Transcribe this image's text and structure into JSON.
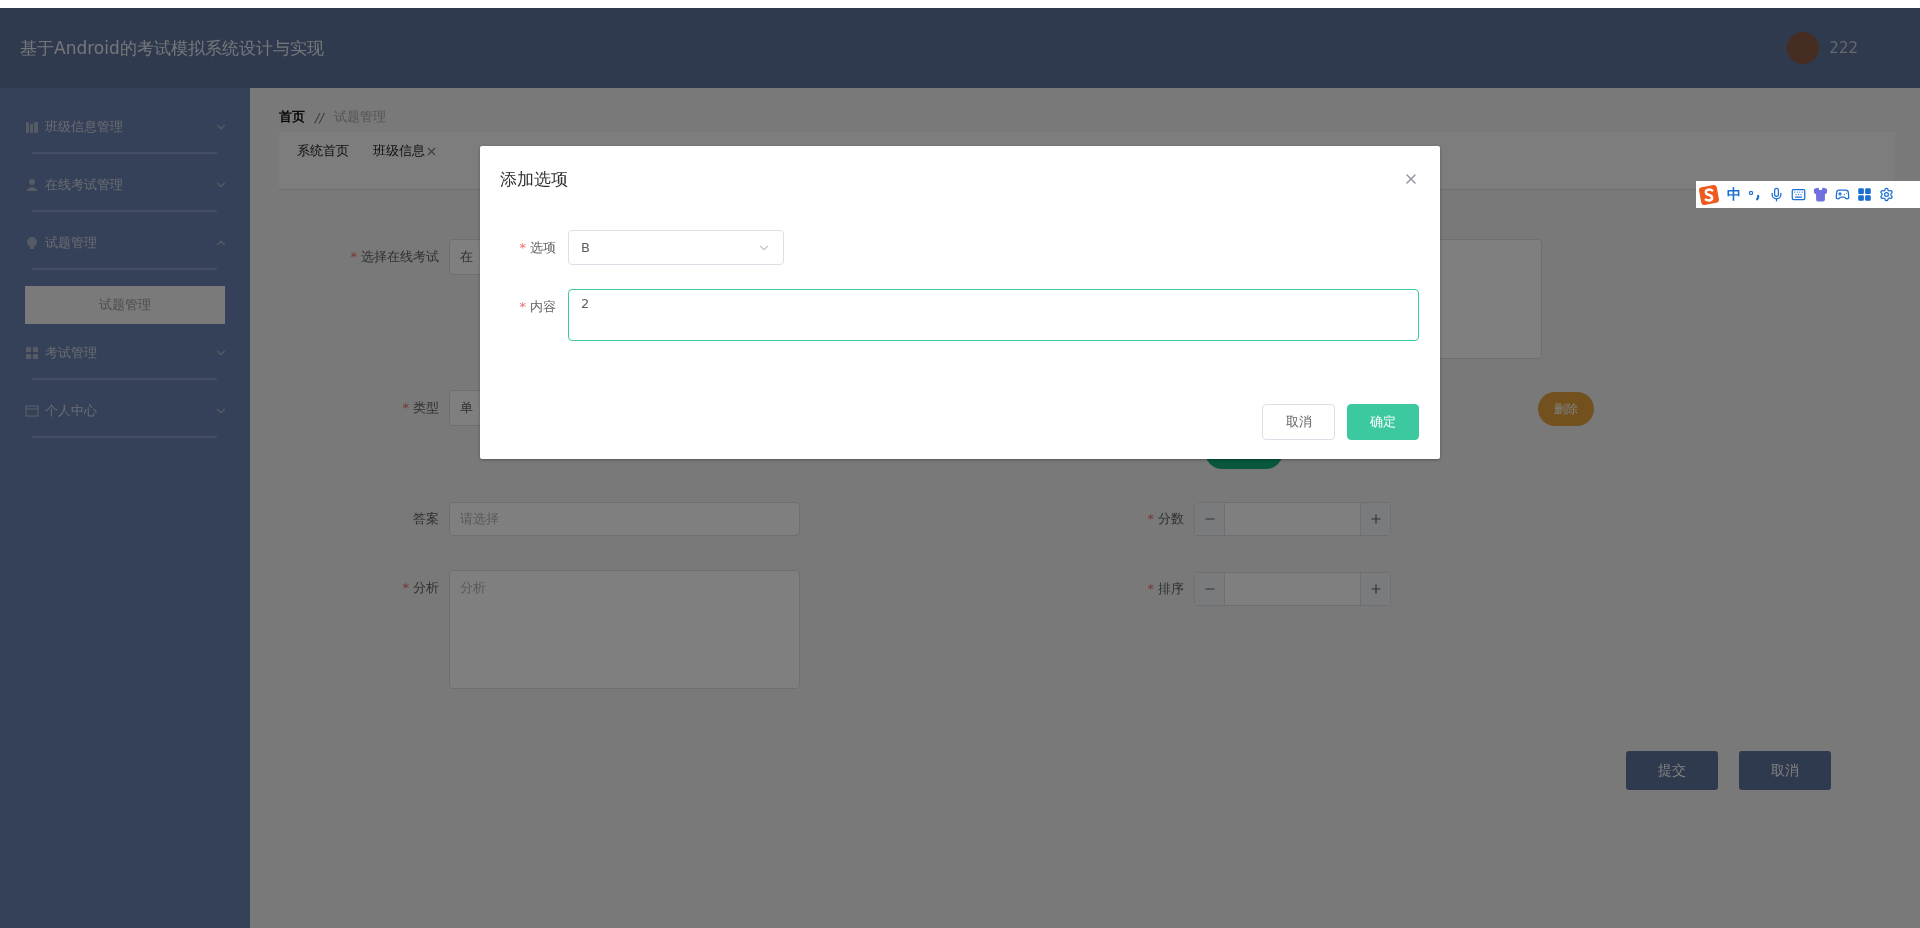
{
  "header": {
    "title": "基于Android的考试模拟系统设计与实现",
    "user": "222"
  },
  "sidebar": {
    "items": [
      {
        "label": "班级信息管理",
        "expanded": false
      },
      {
        "label": "在线考试管理",
        "expanded": false
      },
      {
        "label": "试题管理",
        "expanded": true,
        "children": [
          {
            "label": "试题管理",
            "selected": true
          }
        ]
      },
      {
        "label": "考试管理",
        "expanded": false
      },
      {
        "label": "个人中心",
        "expanded": false
      }
    ]
  },
  "breadcrumb": {
    "items": [
      "首页",
      "试题管理"
    ],
    "separator": "//"
  },
  "tabs": [
    {
      "label": "系统首页",
      "closable": false
    },
    {
      "label": "班级信息",
      "closable": true
    }
  ],
  "form": {
    "exam": {
      "label": "选择在线考试",
      "mark": "*",
      "value": "在"
    },
    "type": {
      "label": "类型",
      "mark": "*",
      "value": "单"
    },
    "delete_button": "删除",
    "answer": {
      "label": "答案",
      "placeholder": "请选择"
    },
    "analysis": {
      "label": "分析",
      "mark": "*",
      "placeholder": "分析"
    },
    "score": {
      "label": "分数",
      "mark": "*"
    },
    "order": {
      "label": "排序",
      "mark": "*"
    },
    "actions": [
      "提交",
      "取消"
    ]
  },
  "modal": {
    "title": "添加选项",
    "fields": [
      {
        "kind": "select",
        "label": "选项",
        "mark": "*",
        "value": "B",
        "focused": false
      },
      {
        "kind": "textarea",
        "label": "内容",
        "mark": "*",
        "value": "2",
        "focused": true
      }
    ],
    "buttons": [
      {
        "label": "取消",
        "primary": false
      },
      {
        "label": "确定",
        "primary": true
      }
    ]
  },
  "ime": {
    "mode": "中"
  }
}
